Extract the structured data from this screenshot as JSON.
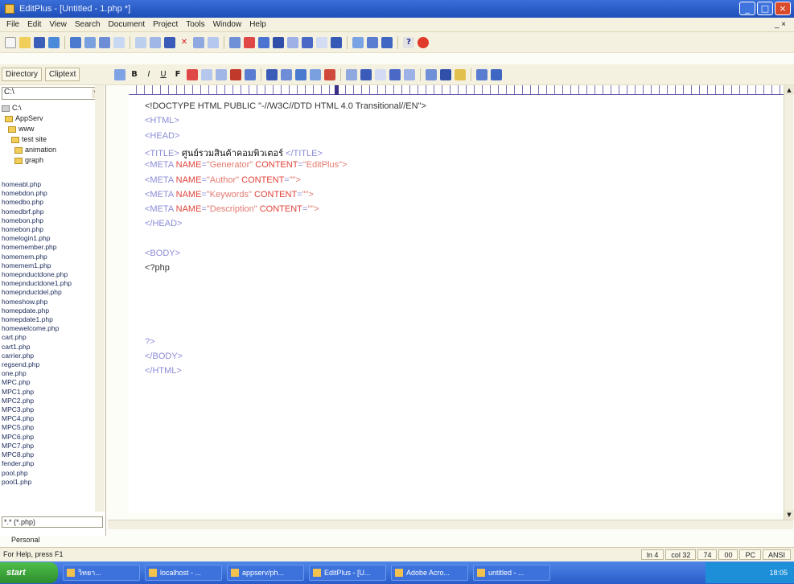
{
  "window": {
    "title": "EditPlus - [Untitled - 1.php *]"
  },
  "menu": [
    "File",
    "Edit",
    "View",
    "Search",
    "Document",
    "Project",
    "Tools",
    "Window",
    "Help"
  ],
  "menu_right": "_ ×",
  "panel_tabs": [
    "Directory",
    "Cliptext"
  ],
  "left_panel": {
    "path": "C:\\",
    "tree": [
      "C:\\",
      "AppServ",
      "www",
      "test site",
      "animation",
      "graph"
    ],
    "files": [
      "homeabl.php",
      "homebdon.php",
      "homedbo.php",
      "homedbrf.php",
      "homebon.php",
      "homebon.php",
      "homelogin1.php",
      "homemember.php",
      "homemem.php",
      "homemem1.php",
      "homepnductdone.php",
      "homepnductdone1.php",
      "homepnductdel.php",
      "homeshow.php",
      "homepdate.php",
      "homepdate1.php",
      "homewelcome.php",
      "cart.php",
      "cart1.php",
      "carrier.php",
      "regsend.php",
      "one.php",
      "MPC.php",
      "MPC1.php",
      "MPC2.php",
      "MPC3.php",
      "MPC4.php",
      "MPC5.php",
      "MPC6.php",
      "MPC7.php",
      "MPC8.php",
      "fender.php",
      "pool.php",
      "pool1.php"
    ],
    "filter": "*.* (*.php)",
    "footer": "Personal"
  },
  "editor": {
    "lines": [
      {
        "segs": [
          {
            "c": "dark",
            "t": "<!DOCTYPE HTML PUBLIC \"-//W3C//DTD HTML 4.0 Transitional//EN\">"
          }
        ]
      },
      {
        "segs": [
          {
            "c": "tag",
            "t": "<HTML>"
          }
        ]
      },
      {
        "segs": [
          {
            "c": "tag",
            "t": "<HEAD>"
          }
        ]
      },
      {
        "segs": [
          {
            "c": "tag",
            "t": "<TITLE> "
          },
          {
            "c": "thai",
            "t": "ศูนย์รวมสินค้าคอมพิวเตอร์"
          },
          {
            "c": "tag",
            "t": " </TITLE>"
          }
        ]
      },
      {
        "segs": [
          {
            "c": "tag",
            "t": "<META "
          },
          {
            "c": "attr",
            "t": "NAME"
          },
          {
            "c": "tag",
            "t": "="
          },
          {
            "c": "val",
            "t": "\"Generator\" "
          },
          {
            "c": "attr",
            "t": "CONTENT"
          },
          {
            "c": "tag",
            "t": "="
          },
          {
            "c": "val",
            "t": "\"EditPlus\">"
          }
        ]
      },
      {
        "segs": [
          {
            "c": "tag",
            "t": "<META "
          },
          {
            "c": "attr",
            "t": "NAME"
          },
          {
            "c": "tag",
            "t": "="
          },
          {
            "c": "val",
            "t": "\"Author\" "
          },
          {
            "c": "attr",
            "t": "CONTENT"
          },
          {
            "c": "tag",
            "t": "="
          },
          {
            "c": "val",
            "t": "\"\">"
          }
        ]
      },
      {
        "segs": [
          {
            "c": "tag",
            "t": "<META "
          },
          {
            "c": "attr",
            "t": "NAME"
          },
          {
            "c": "tag",
            "t": "="
          },
          {
            "c": "val",
            "t": "\"Keywords\" "
          },
          {
            "c": "attr",
            "t": "CONTENT"
          },
          {
            "c": "tag",
            "t": "="
          },
          {
            "c": "val",
            "t": "\"\">"
          }
        ]
      },
      {
        "segs": [
          {
            "c": "tag",
            "t": "<META "
          },
          {
            "c": "attr",
            "t": "NAME"
          },
          {
            "c": "tag",
            "t": "="
          },
          {
            "c": "val",
            "t": "\"Description\" "
          },
          {
            "c": "attr",
            "t": "CONTENT"
          },
          {
            "c": "tag",
            "t": "="
          },
          {
            "c": "val",
            "t": "\"\">"
          }
        ]
      },
      {
        "segs": [
          {
            "c": "tag",
            "t": "</HEAD>"
          }
        ]
      },
      {
        "segs": [
          {
            "c": "tag",
            "t": ""
          }
        ]
      },
      {
        "segs": [
          {
            "c": "tag",
            "t": "<BODY>"
          }
        ]
      },
      {
        "segs": [
          {
            "c": "dark",
            "t": "<?php"
          }
        ]
      },
      {
        "segs": [
          {
            "c": "tag",
            "t": ""
          }
        ]
      },
      {
        "segs": [
          {
            "c": "tag",
            "t": ""
          }
        ]
      },
      {
        "segs": [
          {
            "c": "tag",
            "t": ""
          }
        ]
      },
      {
        "segs": [
          {
            "c": "tag",
            "t": ""
          }
        ]
      },
      {
        "segs": [
          {
            "c": "tag",
            "t": "?>"
          }
        ]
      },
      {
        "segs": [
          {
            "c": "tag",
            "t": "</BODY>"
          }
        ]
      },
      {
        "segs": [
          {
            "c": "tag",
            "t": "</HTML>"
          }
        ]
      }
    ]
  },
  "status": {
    "text": "For Help, press F1",
    "cells": [
      "ln 4",
      "col 32",
      "74",
      "00",
      "PC",
      "ANSI"
    ]
  },
  "taskbar": {
    "start": "start",
    "items": [
      "วิทยา...",
      "localhost - ...",
      "appserv/ph...",
      "EditPlus - [U...",
      "Adobe Acro...",
      "untitled - ..."
    ],
    "clock": "18:05"
  },
  "colors": {
    "accent": "#2a5cc9",
    "tag": "#8b8bd8",
    "attr": "#e0433a"
  }
}
